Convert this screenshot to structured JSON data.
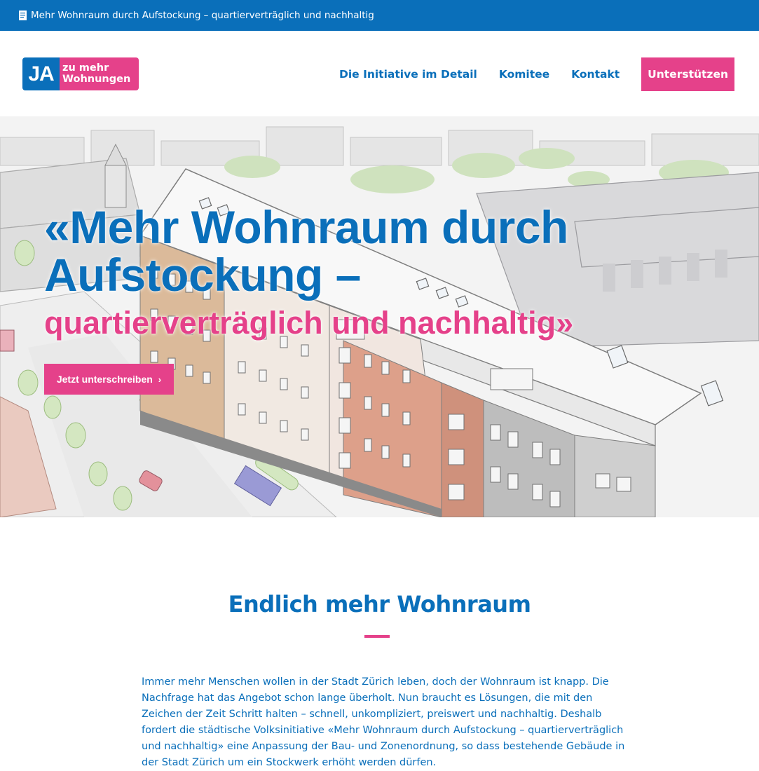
{
  "topbar": {
    "icon": "document-icon",
    "text": "Mehr Wohnraum durch Aufstockung – quartierverträglich und nachhaltig"
  },
  "logo": {
    "ja": "JA",
    "line1": "zu mehr",
    "line2": "Wohnungen"
  },
  "nav": {
    "items": [
      {
        "label": "Die Initiative im Detail"
      },
      {
        "label": "Komitee"
      },
      {
        "label": "Kontakt"
      }
    ],
    "cta_label": "Unterstützen"
  },
  "hero": {
    "title_line1": "«Mehr Wohnraum durch",
    "title_line2": "Aufstockung –",
    "subtitle": "quartierverträglich und nachhaltig»",
    "button_label": "Jetzt unterschreiben",
    "button_icon": "chevron-right-icon"
  },
  "content": {
    "heading": "Endlich mehr Wohnraum",
    "paragraph": "Immer mehr Menschen wollen in der Stadt Zürich leben, doch der Wohnraum ist knapp. Die Nachfrage hat das Angebot schon lange überholt. Nun braucht es Lösungen, die mit den Zeichen der Zeit Schritt halten – schnell, unkompliziert, preiswert und nachhaltig. Deshalb fordert die städtische Volksinitiative «Mehr Wohnraum durch Aufstockung – quartierverträglich und nachhaltig» eine Anpassung der Bau- und Zonenordnung, so dass bestehende Gebäude in der Stadt Zürich um ein Stockwerk erhöht werden dürfen."
  },
  "colors": {
    "primary_blue": "#0a6fba",
    "accent_pink": "#e5418a"
  }
}
